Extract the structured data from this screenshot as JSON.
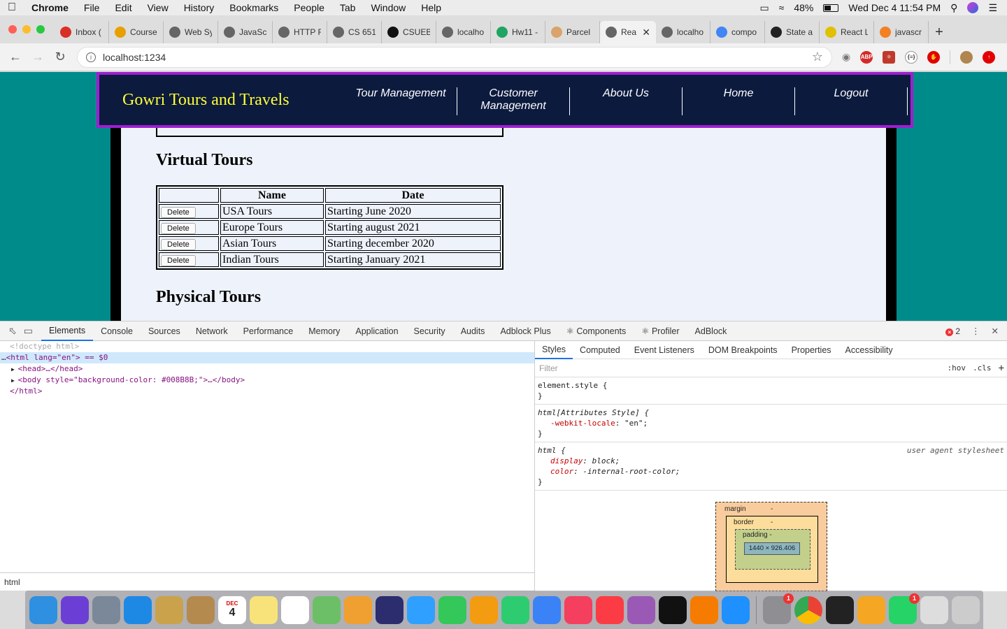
{
  "menubar": {
    "app": "Chrome",
    "items": [
      "File",
      "Edit",
      "View",
      "History",
      "Bookmarks",
      "People",
      "Tab",
      "Window",
      "Help"
    ],
    "battery": "48%",
    "clock": "Wed Dec 4  11:54 PM"
  },
  "tabs": [
    {
      "label": "Inbox (",
      "icon": "gmail-icon",
      "color": "#d93025"
    },
    {
      "label": "Course",
      "icon": "course-icon",
      "color": "#e8a000"
    },
    {
      "label": "Web Sy",
      "icon": "globe-icon",
      "color": "#666"
    },
    {
      "label": "JavaSc",
      "icon": "globe-icon",
      "color": "#666"
    },
    {
      "label": "HTTP F",
      "icon": "globe-icon",
      "color": "#666"
    },
    {
      "label": "CS 651",
      "icon": "globe-icon",
      "color": "#666"
    },
    {
      "label": "CSUEB",
      "icon": "github-icon",
      "color": "#111"
    },
    {
      "label": "localho",
      "icon": "globe-icon",
      "color": "#666"
    },
    {
      "label": "Hw11 -",
      "icon": "drive-icon",
      "color": "#1fa463"
    },
    {
      "label": "Parcel",
      "icon": "parcel-icon",
      "color": "#d9a36a"
    },
    {
      "label": "Rea",
      "icon": "globe-icon",
      "color": "#666",
      "active": true
    },
    {
      "label": "localho",
      "icon": "globe-icon",
      "color": "#666"
    },
    {
      "label": "compo",
      "icon": "google-icon",
      "color": "#4285f4"
    },
    {
      "label": "State a",
      "icon": "react-icon",
      "color": "#222"
    },
    {
      "label": "React L",
      "icon": "react-icon",
      "color": "#e0c000"
    },
    {
      "label": "javascr",
      "icon": "stackoverflow-icon",
      "color": "#f48024"
    }
  ],
  "toolbar": {
    "url": "localhost:1234"
  },
  "site": {
    "brand": "Gowri Tours and Travels",
    "nav": [
      "Tour Management",
      "Customer Management",
      "About Us",
      "Home",
      "Logout"
    ],
    "virtual_heading": "Virtual Tours",
    "physical_heading": "Physical Tours",
    "table_headers": [
      "",
      "Name",
      "Date"
    ],
    "delete_label": "Delete",
    "rows": [
      {
        "name": "USA Tours",
        "date": "Starting June 2020"
      },
      {
        "name": "Europe Tours",
        "date": "Starting august 2021"
      },
      {
        "name": "Asian Tours",
        "date": "Starting december 2020"
      },
      {
        "name": "Indian Tours",
        "date": "Starting January 2021"
      }
    ]
  },
  "devtools": {
    "tabs": [
      "Elements",
      "Console",
      "Sources",
      "Network",
      "Performance",
      "Memory",
      "Application",
      "Security",
      "Audits",
      "Adblock Plus",
      "⚛ Components",
      "⚛ Profiler",
      "AdBlock"
    ],
    "error_count": "2",
    "dom": {
      "doctype": "<!doctype html>",
      "html_open": "<html lang=\"en\"> == $0",
      "head": "<head>…</head>",
      "body": "<body style=\"background-color: #008B8B;\">…</body>",
      "html_close": "</html>"
    },
    "breadcrumb": "html",
    "styles_tabs": [
      "Styles",
      "Computed",
      "Event Listeners",
      "DOM Breakpoints",
      "Properties",
      "Accessibility"
    ],
    "filter_placeholder": "Filter",
    "hov": ":hov",
    "cls": ".cls",
    "rules": {
      "r1_sel": "element.style {",
      "r2_sel": "html[Attributes Style] {",
      "r2_prop": "-webkit-locale",
      "r2_val": "\"en\";",
      "r3_sel": "html {",
      "r3_src": "user agent stylesheet",
      "r3_p1": "display",
      "r3_v1": "block;",
      "r3_p2": "color",
      "r3_v2": "-internal-root-color;",
      "close": "}"
    },
    "boxmodel": {
      "margin": "margin",
      "border": "border",
      "padding": "padding",
      "dash": "-",
      "content": "1440 × 926.406"
    }
  },
  "dock": {
    "apps": [
      "Finder",
      "Siri",
      "Launchpad",
      "Safari",
      "Mail",
      "Contacts",
      "Calendar",
      "Notes",
      "Reminders",
      "Maps",
      "Photos",
      "Eclipse",
      "Messages",
      "FaceTime",
      "Pages",
      "Numbers",
      "Keynote",
      "News",
      "Music",
      "Podcasts",
      "TV",
      "Books",
      "App Store",
      "System Preferences",
      "Chrome",
      "Terminal",
      "Sublime Text",
      "WhatsApp",
      "Archive",
      "Trash"
    ],
    "calendar_day": "4",
    "calendar_month": "DEC",
    "badge": "1"
  }
}
